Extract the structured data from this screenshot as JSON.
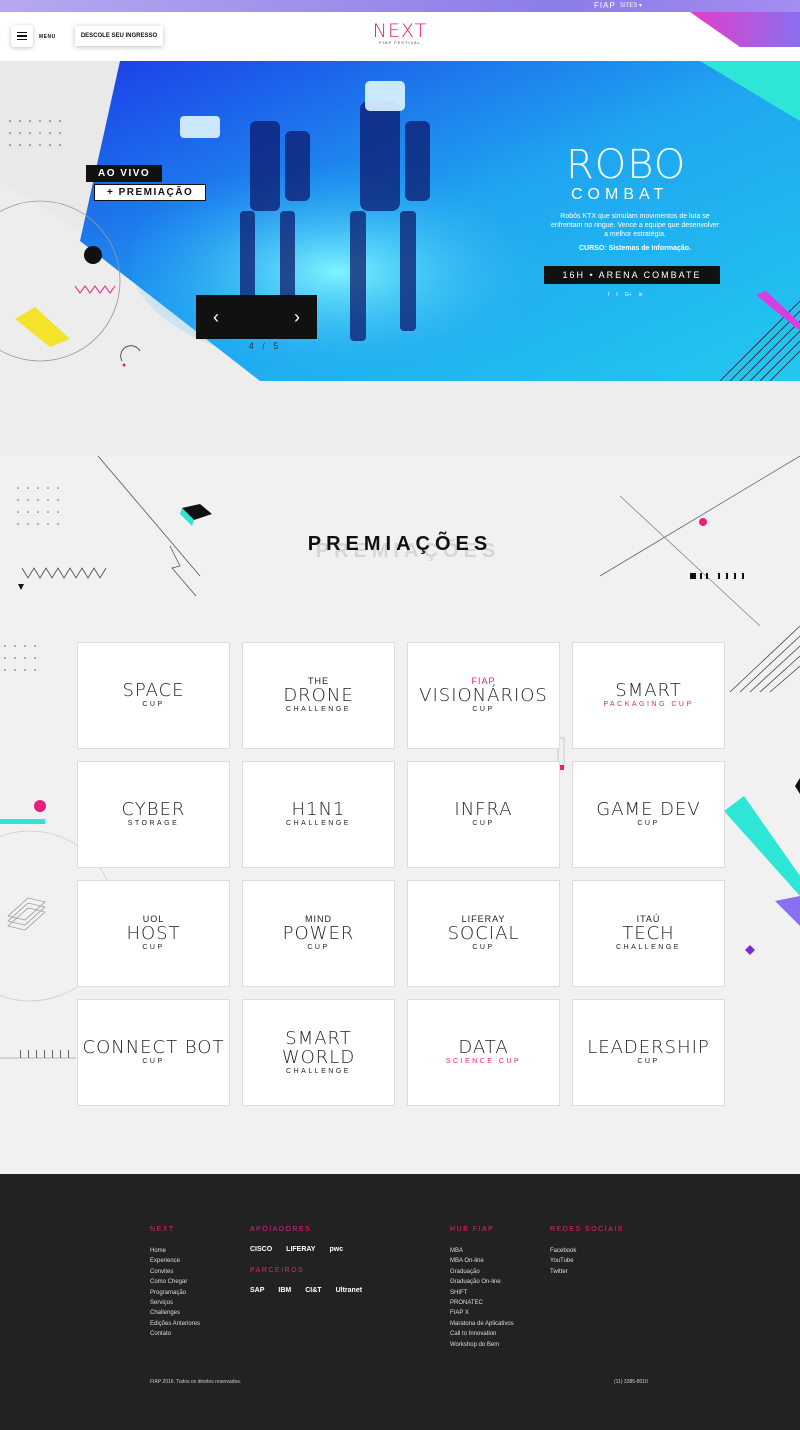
{
  "topbar": {
    "brand": "FIAP",
    "sites": "SITES ▾"
  },
  "header": {
    "menu_label": "MENU",
    "ticket_button": "DESCOLE SEU INGRESSO",
    "logo": "NEXT",
    "logo_sub": "FIAP FESTIVAL"
  },
  "hero": {
    "badge_live": "AO VIVO",
    "badge_prize": "+ PREMIAÇÃO",
    "counter": "4 / 5",
    "title": "ROBO",
    "subtitle": "COMBAT",
    "description": "Robôs KTX que simulam movimentos de luta se enfrentam no ringue. Vence a equipe que desenvolver a melhor estratégia.",
    "course": "CURSO: Sistemas de Informação.",
    "time_place": "16H • ARENA COMBATE",
    "socials": [
      "f",
      "t",
      "G+",
      "in"
    ],
    "prev_icon": "chevron-left-icon",
    "next_icon": "chevron-right-icon"
  },
  "section": {
    "title": "PREMIAÇÕES"
  },
  "awards": [
    {
      "top": "",
      "main": "SPACE",
      "bottom": "CUP"
    },
    {
      "top": "THE",
      "main": "DRONE",
      "bottom": "CHALLENGE"
    },
    {
      "top": "FIAP",
      "main": "VISIONÁRIOS",
      "bottom": "CUP"
    },
    {
      "top": "",
      "main": "SMART",
      "bottom": "PACKAGING CUP"
    },
    {
      "top": "",
      "main": "CYBER",
      "bottom": "STORAGE"
    },
    {
      "top": "",
      "main": "H1N1",
      "bottom": "CHALLENGE"
    },
    {
      "top": "",
      "main": "INFRA",
      "bottom": "CUP"
    },
    {
      "top": "",
      "main": "GAME DEV",
      "bottom": "CUP"
    },
    {
      "top": "UOL",
      "main": "HOST",
      "bottom": "CUP"
    },
    {
      "top": "MIND",
      "main": "POWER",
      "bottom": "CUP"
    },
    {
      "top": "LIFERAY",
      "main": "SOCIAL",
      "bottom": "CUP"
    },
    {
      "top": "ITAÚ",
      "main": "TECH",
      "bottom": "CHALLENGE"
    },
    {
      "top": "",
      "main": "CONNECT BOT",
      "bottom": "CUP"
    },
    {
      "top": "",
      "main": "SMART WORLD",
      "bottom": "CHALLENGE"
    },
    {
      "top": "",
      "main": "DATA",
      "bottom": "SCIENCE CUP"
    },
    {
      "top": "",
      "main": "LEADERSHIP",
      "bottom": "CUP"
    }
  ],
  "footer": {
    "next_title": "NEXT",
    "next_links": [
      "Home",
      "Experience",
      "Convites",
      "Como Chegar",
      "Programação",
      "Serviços",
      "Challenges",
      "Edições Anteriores",
      "Contato"
    ],
    "supporters_title": "APOIADORES",
    "supporters": [
      "CISCO",
      "LIFERAY",
      "pwc"
    ],
    "partners_title": "PARCEIROS",
    "partners": [
      "SAP",
      "IBM",
      "CI&T",
      "Ultranet"
    ],
    "hub_title": "HUB FIAP",
    "hub_links": [
      "MBA",
      "MBA On-line",
      "Graduação",
      "Graduação On-line",
      "SHIFT",
      "PRONATEC",
      "FIAP X",
      "Maratona de Aplicativos",
      "Call to Innovation",
      "Workshop do Bem"
    ],
    "social_title": "REDES SOCIAIS",
    "social_links": [
      "Facebook",
      "YouTube",
      "Twitter"
    ],
    "copyright": "FIAP 2016. Todos os direitos reservados.",
    "phone": "(11) 3385-8010"
  },
  "colors": {
    "pink": "#e8207c",
    "cyan": "#2ee6d6",
    "purple": "#8a6ff0",
    "blue": "#1a3fe0"
  }
}
